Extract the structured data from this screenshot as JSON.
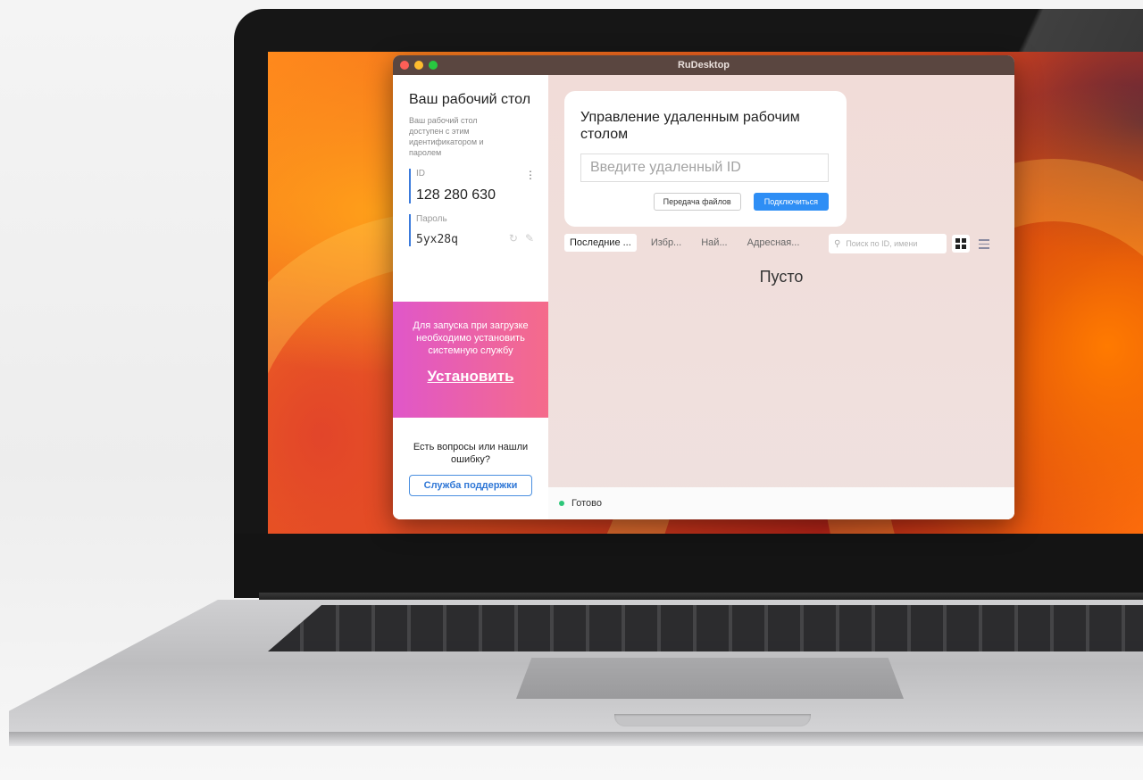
{
  "window": {
    "title": "RuDesktop"
  },
  "sidebar": {
    "title": "Ваш рабочий стол",
    "description": "Ваш рабочий стол доступен с этим идентификатором и паролем",
    "id": {
      "label": "ID",
      "value": "128 280 630",
      "menu_icon": "kebab-icon"
    },
    "password": {
      "label": "Пароль",
      "value": "5yx28q",
      "icons": [
        "refresh-icon",
        "edit-icon"
      ]
    },
    "promo": {
      "text": "Для запуска при загрузке необходимо установить системную службу",
      "link": "Установить",
      "colors": [
        "#e057c9",
        "#f56b8a"
      ]
    },
    "help": {
      "text": "Есть вопросы или нашли ошибку?",
      "button": "Служба поддержки"
    }
  },
  "main": {
    "card": {
      "title": "Управление удаленным рабочим столом",
      "input_placeholder": "Введите удаленный ID",
      "files_button": "Передача файлов",
      "connect_button": "Подключиться"
    },
    "tabs": [
      {
        "label": "Последние ...",
        "active": true
      },
      {
        "label": "Избр...",
        "active": false
      },
      {
        "label": "Най...",
        "active": false
      },
      {
        "label": "Адресная...",
        "active": false
      }
    ],
    "search": {
      "placeholder": "Поиск по ID, имени"
    },
    "view_icons": [
      "grid-icon",
      "list-icon"
    ],
    "empty_text": "Пусто"
  },
  "statusbar": {
    "text": "Готово",
    "color": "#2ec77a"
  },
  "accent": "#2e8ef5"
}
